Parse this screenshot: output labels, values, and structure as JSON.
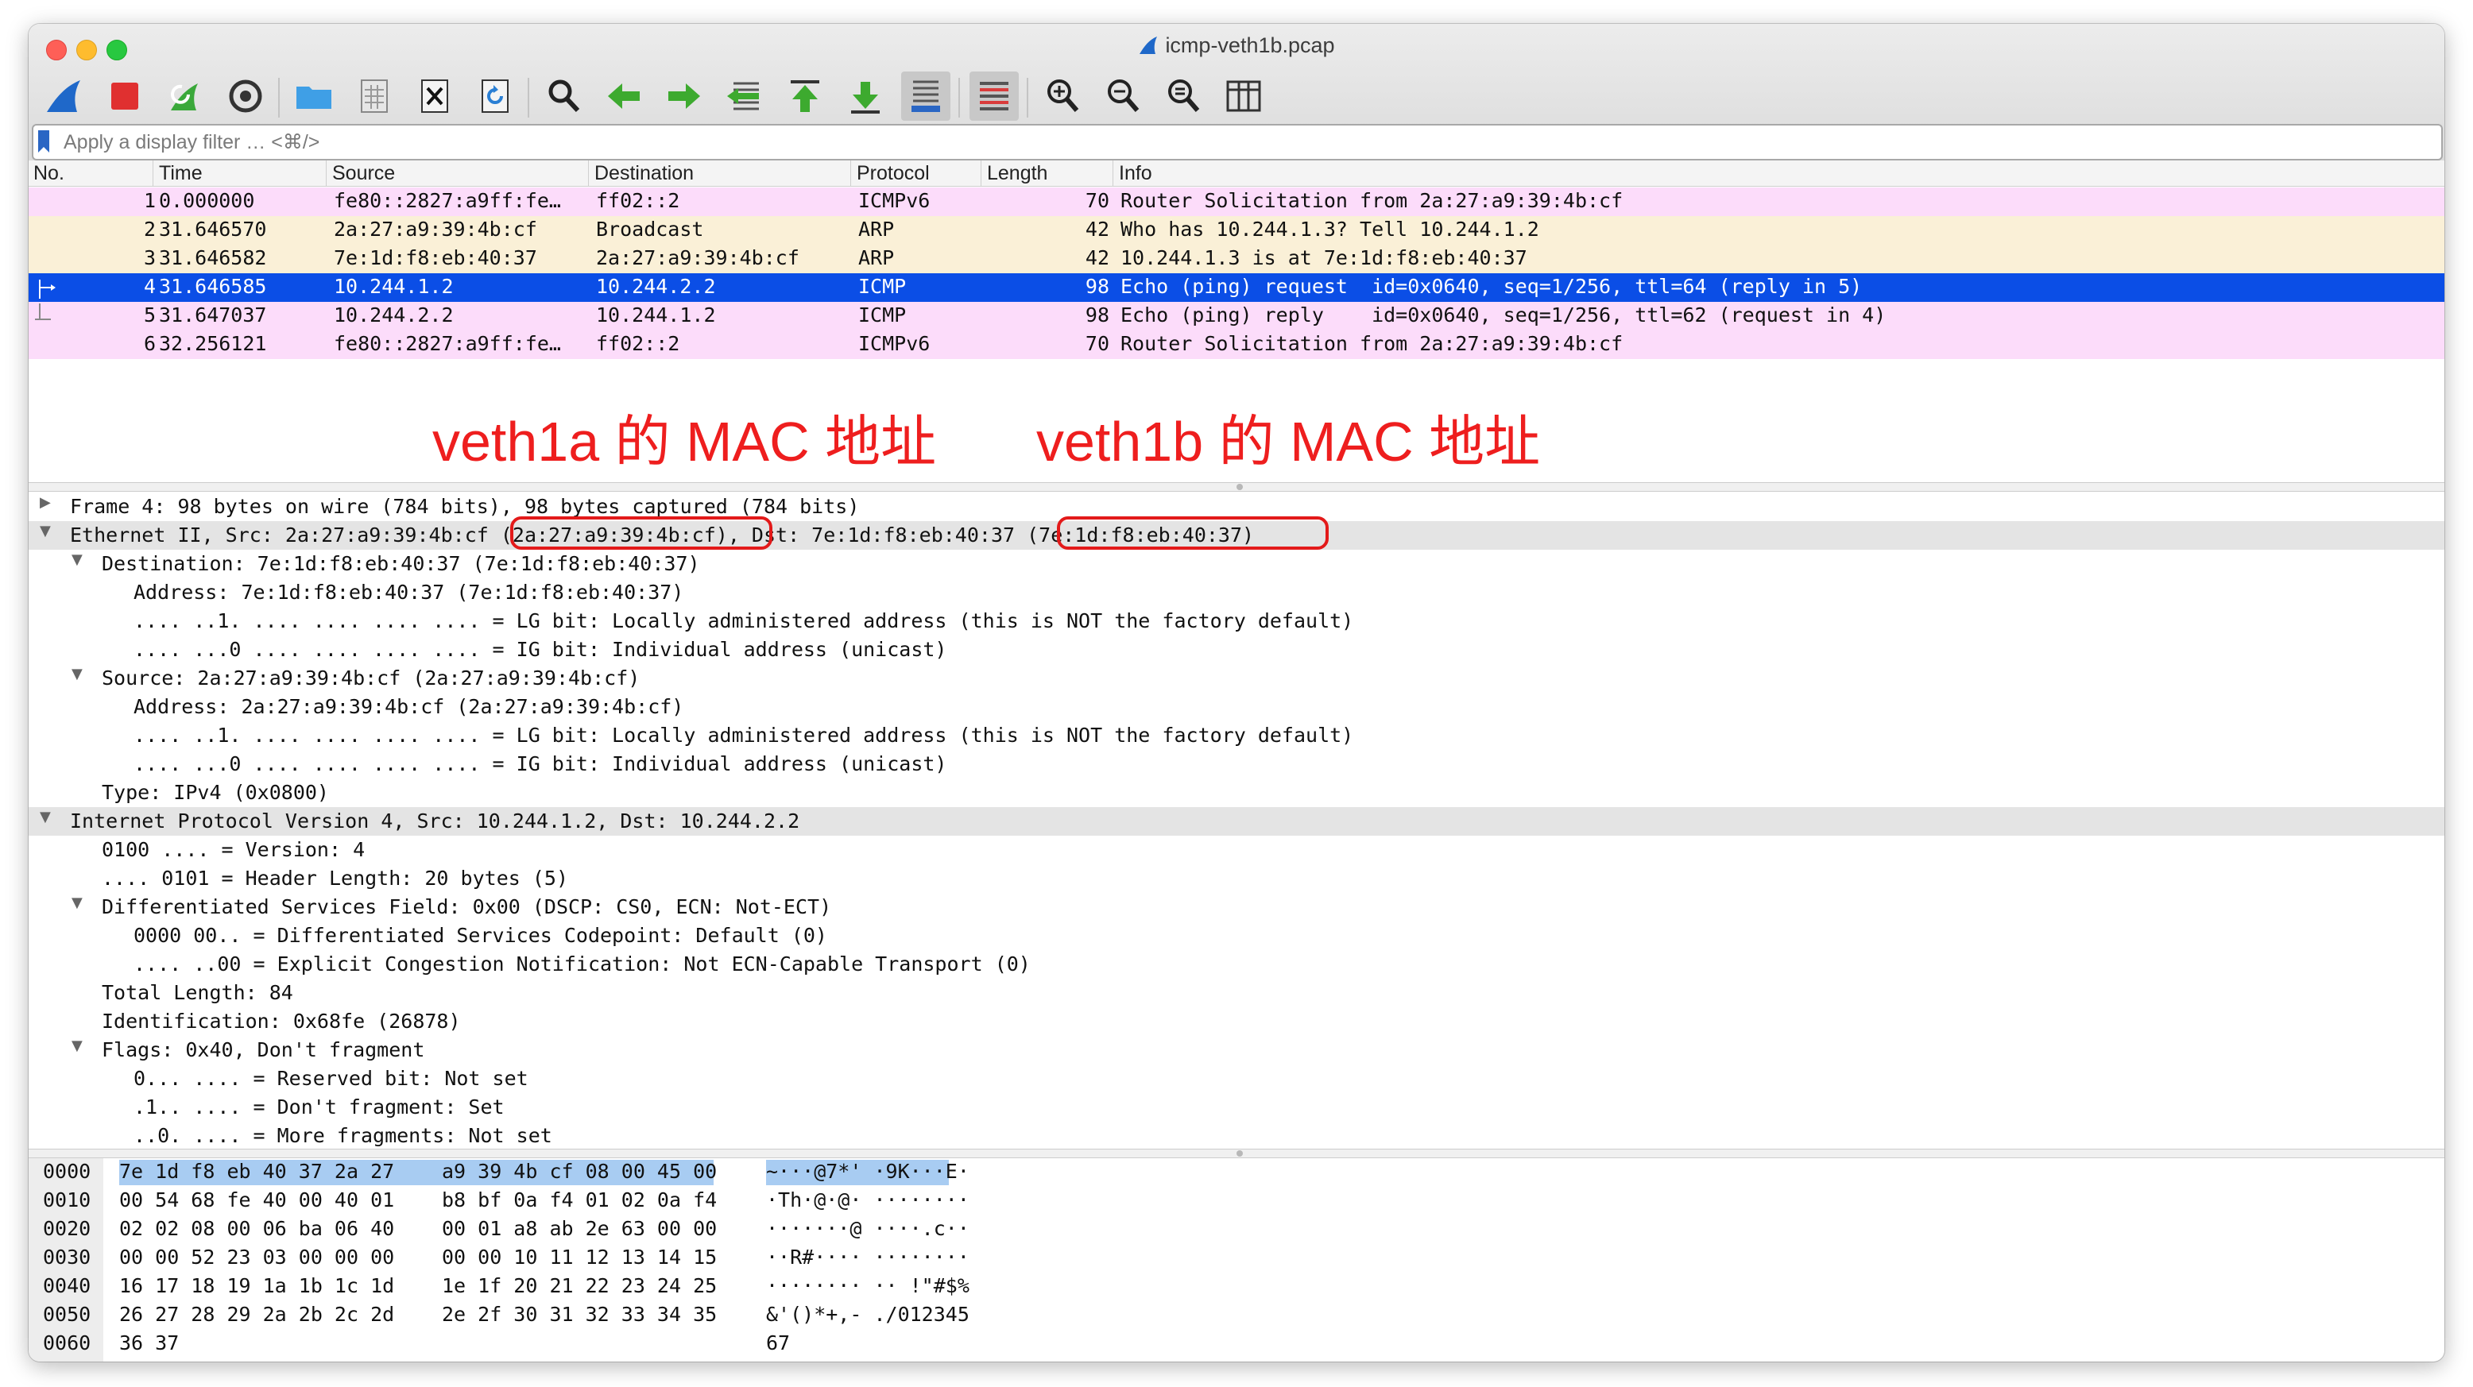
{
  "window": {
    "title": "icmp-veth1b.pcap"
  },
  "filter": {
    "placeholder": "Apply a display filter … <⌘/>"
  },
  "columns": [
    "No.",
    "Time",
    "Source",
    "Destination",
    "Protocol",
    "Length",
    "Info"
  ],
  "packets": [
    {
      "no": "1",
      "time": "0.000000",
      "src": "fe80::2827:a9ff:fe…",
      "dst": "ff02::2",
      "proto": "ICMPv6",
      "len": "70",
      "info": "Router Solicitation from 2a:27:a9:39:4b:cf"
    },
    {
      "no": "2",
      "time": "31.646570",
      "src": "2a:27:a9:39:4b:cf",
      "dst": "Broadcast",
      "proto": "ARP",
      "len": "42",
      "info": "Who has 10.244.1.3? Tell 10.244.1.2"
    },
    {
      "no": "3",
      "time": "31.646582",
      "src": "7e:1d:f8:eb:40:37",
      "dst": "2a:27:a9:39:4b:cf",
      "proto": "ARP",
      "len": "42",
      "info": "10.244.1.3 is at 7e:1d:f8:eb:40:37"
    },
    {
      "no": "4",
      "time": "31.646585",
      "src": "10.244.1.2",
      "dst": "10.244.2.2",
      "proto": "ICMP",
      "len": "98",
      "info": "Echo (ping) request  id=0x0640, seq=1/256, ttl=64 (reply in 5)"
    },
    {
      "no": "5",
      "time": "31.647037",
      "src": "10.244.2.2",
      "dst": "10.244.1.2",
      "proto": "ICMP",
      "len": "98",
      "info": "Echo (ping) reply    id=0x0640, seq=1/256, ttl=62 (request in 4)"
    },
    {
      "no": "6",
      "time": "32.256121",
      "src": "fe80::2827:a9ff:fe…",
      "dst": "ff02::2",
      "proto": "ICMPv6",
      "len": "70",
      "info": "Router Solicitation from 2a:27:a9:39:4b:cf"
    }
  ],
  "annotations": {
    "left": "veth1a 的 MAC 地址",
    "right": "veth1b 的 MAC 地址"
  },
  "details": [
    "Frame 4: 98 bytes on wire (784 bits), 98 bytes captured (784 bits)",
    "Ethernet II, Src: 2a:27:a9:39:4b:cf (2a:27:a9:39:4b:cf), Dst: 7e:1d:f8:eb:40:37 (7e:1d:f8:eb:40:37)",
    "Destination: 7e:1d:f8:eb:40:37 (7e:1d:f8:eb:40:37)",
    "Address: 7e:1d:f8:eb:40:37 (7e:1d:f8:eb:40:37)",
    ".... ..1. .... .... .... .... = LG bit: Locally administered address (this is NOT the factory default)",
    ".... ...0 .... .... .... .... = IG bit: Individual address (unicast)",
    "Source: 2a:27:a9:39:4b:cf (2a:27:a9:39:4b:cf)",
    "Address: 2a:27:a9:39:4b:cf (2a:27:a9:39:4b:cf)",
    ".... ..1. .... .... .... .... = LG bit: Locally administered address (this is NOT the factory default)",
    ".... ...0 .... .... .... .... = IG bit: Individual address (unicast)",
    "Type: IPv4 (0x0800)",
    "Internet Protocol Version 4, Src: 10.244.1.2, Dst: 10.244.2.2",
    "0100 .... = Version: 4",
    ".... 0101 = Header Length: 20 bytes (5)",
    "Differentiated Services Field: 0x00 (DSCP: CS0, ECN: Not-ECT)",
    "0000 00.. = Differentiated Services Codepoint: Default (0)",
    ".... ..00 = Explicit Congestion Notification: Not ECN-Capable Transport (0)",
    "Total Length: 84",
    "Identification: 0x68fe (26878)",
    "Flags: 0x40, Don't fragment",
    "0... .... = Reserved bit: Not set",
    ".1.. .... = Don't fragment: Set",
    "..0. .... = More fragments: Not set"
  ],
  "bytes": [
    {
      "offset": "0000",
      "hex1": "7e 1d f8 eb 40 37 2a 27",
      "hex2": "a9 39 4b cf 08 00 45 00",
      "ascii": "~···@7*' ·9K···E·"
    },
    {
      "offset": "0010",
      "hex1": "00 54 68 fe 40 00 40 01",
      "hex2": "b8 bf 0a f4 01 02 0a f4",
      "ascii": "·Th·@·@· ········"
    },
    {
      "offset": "0020",
      "hex1": "02 02 08 00 06 ba 06 40",
      "hex2": "00 01 a8 ab 2e 63 00 00",
      "ascii": "·······@ ····.c··"
    },
    {
      "offset": "0030",
      "hex1": "00 00 52 23 03 00 00 00",
      "hex2": "00 00 10 11 12 13 14 15",
      "ascii": "··R#···· ········"
    },
    {
      "offset": "0040",
      "hex1": "16 17 18 19 1a 1b 1c 1d",
      "hex2": "1e 1f 20 21 22 23 24 25",
      "ascii": "········ ·· !\"#$%"
    },
    {
      "offset": "0050",
      "hex1": "26 27 28 29 2a 2b 2c 2d",
      "hex2": "2e 2f 30 31 32 33 34 35",
      "ascii": "&'()*+,- ./012345"
    },
    {
      "offset": "0060",
      "hex1": "36 37",
      "hex2": "",
      "ascii": "67"
    }
  ]
}
